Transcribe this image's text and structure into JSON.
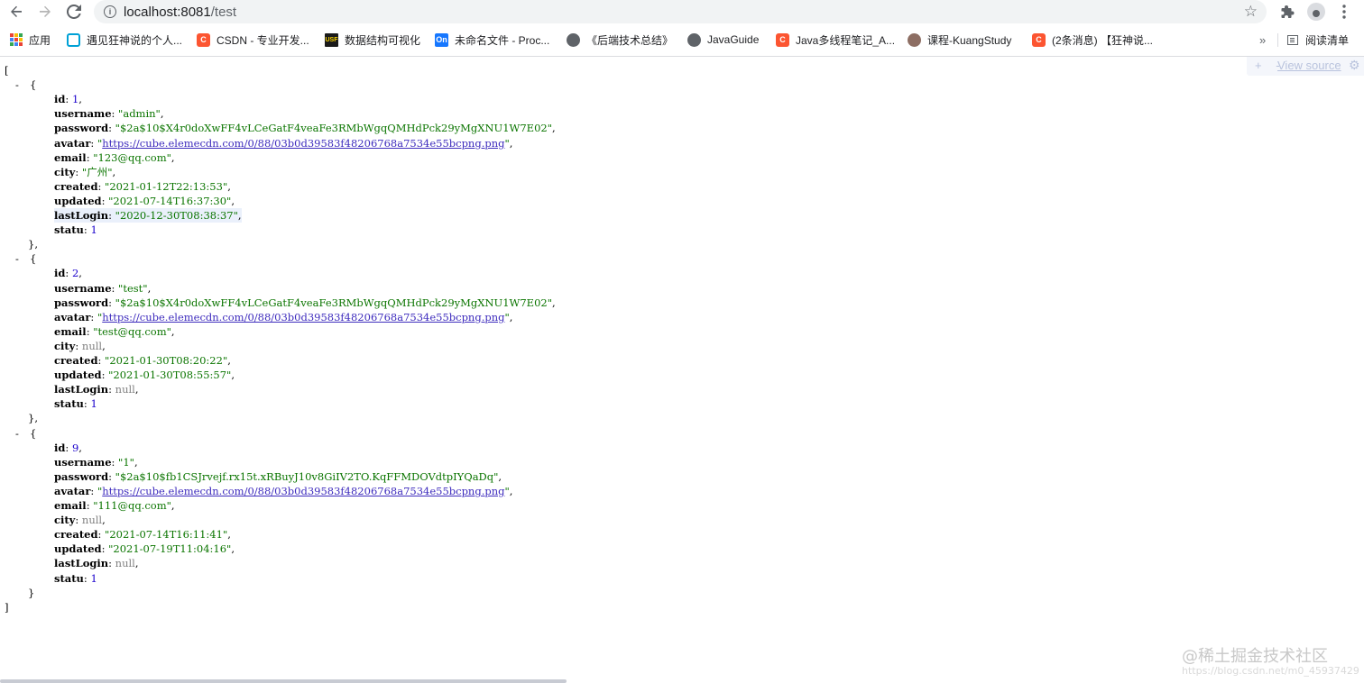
{
  "browser": {
    "url_host": "localhost:8081",
    "url_path": "/test",
    "back_icon": "arrow-left-icon",
    "forward_icon": "arrow-right-icon",
    "reload_icon": "reload-icon"
  },
  "bookmarks": [
    {
      "label": "应用",
      "icon": "apps-grid-icon"
    },
    {
      "label": "遇见狂神说的个人...",
      "icon": "bilibili-icon"
    },
    {
      "label": "CSDN - 专业开发...",
      "icon": "csdn-icon"
    },
    {
      "label": "数据结构可视化",
      "icon": "usf-icon",
      "icon_text": "USF"
    },
    {
      "label": "未命名文件 - Proc...",
      "icon": "processon-icon",
      "icon_text": "On"
    },
    {
      "label": "《后端技术总结》",
      "icon": "globe-icon"
    },
    {
      "label": "JavaGuide",
      "icon": "globe-icon"
    },
    {
      "label": "Java多线程笔记_A...",
      "icon": "csdn-icon"
    },
    {
      "label": "课程-KuangStudy",
      "icon": "kuangstudy-icon"
    },
    {
      "label": "(2条消息) 【狂神说...",
      "icon": "csdn-icon"
    }
  ],
  "bookmarks_more": "»",
  "reading_list": "阅读清单",
  "json_viewer": {
    "view_source": "View source",
    "plus_minus": "+ -"
  },
  "records": [
    {
      "id": "1",
      "username": "\"admin\"",
      "password": "\"$2a$10$X4r0doXwFF4vLCeGatF4veaFe3RMbWgqQMHdPck29yMgXNU1W7E02\"",
      "avatar": "https://cube.elemecdn.com/0/88/03b0d39583f48206768a7534e55bcpng.png",
      "email": "\"123@qq.com\"",
      "city": "\"广州\"",
      "city_is_null": false,
      "created": "\"2021-01-12T22:13:53\"",
      "updated": "\"2021-07-14T16:37:30\"",
      "lastLogin": "\"2020-12-30T08:38:37\"",
      "lastLogin_is_null": false,
      "statu": "1"
    },
    {
      "id": "2",
      "username": "\"test\"",
      "password": "\"$2a$10$X4r0doXwFF4vLCeGatF4veaFe3RMbWgqQMHdPck29yMgXNU1W7E02\"",
      "avatar": "https://cube.elemecdn.com/0/88/03b0d39583f48206768a7534e55bcpng.png",
      "email": "\"test@qq.com\"",
      "city": "null",
      "city_is_null": true,
      "created": "\"2021-01-30T08:20:22\"",
      "updated": "\"2021-01-30T08:55:57\"",
      "lastLogin": "null",
      "lastLogin_is_null": true,
      "statu": "1"
    },
    {
      "id": "9",
      "username": "\"1\"",
      "password": "\"$2a$10$fb1CSJrvejf.rx15t.xRBuyJ10v8GiIV2TO.KqFFMDOVdtpIYQaDq\"",
      "avatar": "https://cube.elemecdn.com/0/88/03b0d39583f48206768a7534e55bcpng.png",
      "email": "\"111@qq.com\"",
      "city": "null",
      "city_is_null": true,
      "created": "\"2021-07-14T16:11:41\"",
      "updated": "\"2021-07-19T11:04:16\"",
      "lastLogin": "null",
      "lastLogin_is_null": true,
      "statu": "1"
    }
  ],
  "watermark": "@稀土掘金技术社区",
  "watermark_url": "https://blog.csdn.net/m0_45937429",
  "colors": {
    "string": "#0b7500",
    "number": "#1a01cc",
    "null": "#808080",
    "link": "#3d2bbd"
  }
}
